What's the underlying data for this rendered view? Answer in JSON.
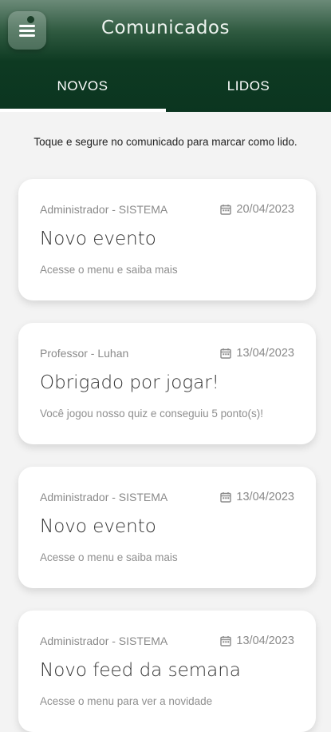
{
  "header": {
    "title": "Comunicados",
    "menu_icon": "hamburger-menu-icon"
  },
  "tabs": [
    {
      "label": "NOVOS",
      "active": true
    },
    {
      "label": "LIDOS",
      "active": false
    }
  ],
  "hint": "Toque e segure no comunicado para marcar como lido.",
  "colors": {
    "header_dark": "#0b3520",
    "background": "#f3f3f3",
    "card": "#ffffff"
  },
  "cards": [
    {
      "author": "Administrador - SISTEMA",
      "date": "20/04/2023",
      "title": "Novo evento",
      "description": "Acesse o menu e saiba mais"
    },
    {
      "author": "Professor - Luhan",
      "date": "13/04/2023",
      "title": "Obrigado por jogar!",
      "description": "Você jogou nosso quiz e conseguiu 5 ponto(s)!"
    },
    {
      "author": "Administrador - SISTEMA",
      "date": "13/04/2023",
      "title": "Novo evento",
      "description": "Acesse o menu e saiba mais"
    },
    {
      "author": "Administrador - SISTEMA",
      "date": "13/04/2023",
      "title": "Novo feed da semana",
      "description": "Acesse o menu para ver a novidade"
    }
  ]
}
